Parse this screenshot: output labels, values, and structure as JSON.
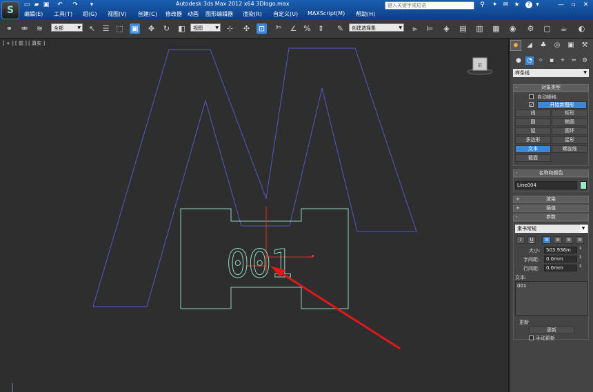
{
  "title_bar": {
    "app_title": "Autodesk 3ds Max  2012 x64",
    "file_name": "3Dlogo.max",
    "search_placeholder": "键入关键字或短语",
    "help_label": "?"
  },
  "menu": {
    "items": [
      "编辑(E)",
      "工具(T)",
      "组(G)",
      "视图(V)",
      "创建(C)",
      "修改器",
      "动画",
      "图形编辑器",
      "渲染(R)",
      "自定义(U)",
      "MAXScript(M)",
      "帮助(H)"
    ]
  },
  "toolbar": {
    "selection_filter": "全部",
    "reference_coord": "视图",
    "named_selection": "创建选择集"
  },
  "viewport": {
    "label": "[ + ] [ 前 ] [ 真实 ]",
    "viewcube_label": "前",
    "text_object": "001",
    "colors": {
      "m_shape": "#5b55c8",
      "h_shape": "#8fd6c0",
      "text": "#8fd6c0",
      "pivot": "#e03030",
      "arrow": "#e01818"
    }
  },
  "command_panel": {
    "category": "样条线",
    "object_type": {
      "header": "对象类型",
      "auto_grid": "自动栅格",
      "start_new_shape": "开始新图形",
      "buttons": [
        "线",
        "矩形",
        "圆",
        "椭圆",
        "弧",
        "圆环",
        "多边形",
        "星形",
        "文本",
        "螺旋线",
        "截面"
      ],
      "selected": "文本"
    },
    "name_color": {
      "header": "名称和颜色",
      "name": "Line004",
      "swatch": "#9de6c8"
    },
    "render_header": "渲染",
    "interp_header": "插值",
    "params": {
      "header": "参数",
      "font": "隶书常规",
      "size_label": "大小:",
      "size_value": "503.936m",
      "kerning_label": "字间距:",
      "kerning_value": "0.0mm",
      "leading_label": "行间距:",
      "leading_value": "0.0mm",
      "text_label": "文本:",
      "text_value": "001",
      "update_header": "更新",
      "update_button": "更新",
      "manual_update": "手动更新"
    }
  }
}
